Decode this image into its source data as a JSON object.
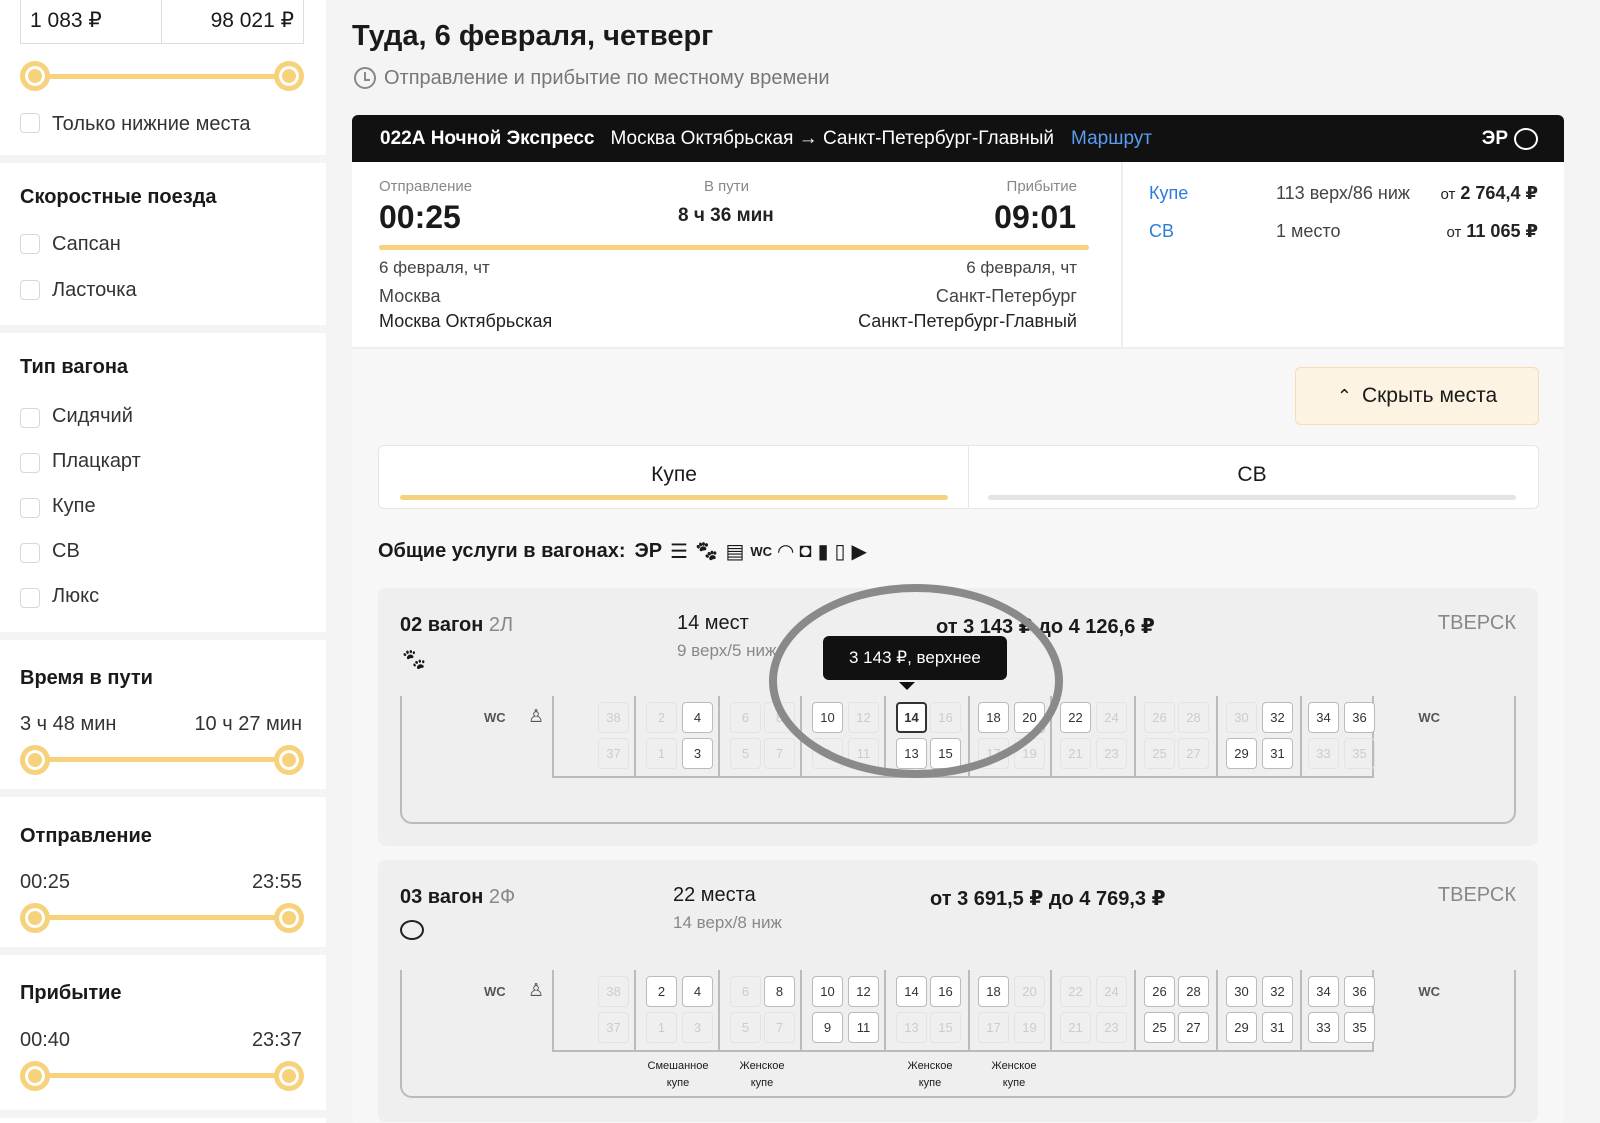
{
  "sidebar": {
    "price": {
      "min": "1 083 ₽",
      "max": "98 021 ₽"
    },
    "only_lower_label": "Только нижние места",
    "fast_trains": {
      "title": "Скоростные поезда",
      "items": [
        "Сапсан",
        "Ласточка"
      ]
    },
    "car_type": {
      "title": "Тип вагона",
      "items": [
        "Сидячий",
        "Плацкарт",
        "Купе",
        "СВ",
        "Люкс"
      ]
    },
    "travel_time": {
      "title": "Время в пути",
      "min": "3 ч 48 мин",
      "max": "10 ч 27 мин"
    },
    "departure": {
      "title": "Отправление",
      "min": "00:25",
      "max": "23:55"
    },
    "arrival": {
      "title": "Прибытие",
      "min": "00:40",
      "max": "23:37"
    }
  },
  "header": {
    "title": "Туда, 6 февраля, четверг",
    "subtitle": "Отправление и прибытие по местному времени"
  },
  "train": {
    "number_name": "022А Ночной Экспресс",
    "route": "Москва Октябрьская → Санкт-Петербург-Главный",
    "route_link": "Маршрут",
    "er_badge": "ЭР",
    "dep_label": "Отправление",
    "dep_time": "00:25",
    "duration_label": "В пути",
    "duration": "8 ч 36 мин",
    "arr_label": "Прибытие",
    "arr_time": "09:01",
    "dep_date": "6 февраля, чт",
    "arr_date": "6 февраля, чт",
    "dep_city": "Москва",
    "dep_station": "Москва Октябрьская",
    "arr_city": "Санкт-Петербург",
    "arr_station": "Санкт-Петербург-Главный",
    "classes": [
      {
        "name": "Купе",
        "seats": "113 верх/86 ниж",
        "from": "от",
        "price": "2 764,4 ₽"
      },
      {
        "name": "СВ",
        "seats": "1 место",
        "from": "от",
        "price": "11 065 ₽"
      }
    ],
    "hide_seats_label": "Скрыть места",
    "tabs": [
      "Купе",
      "СВ"
    ],
    "services_label": "Общие услуги в вагонах:",
    "services_er": "ЭР",
    "services_icons": [
      "bed-linen-icon",
      "pets-icon",
      "shower-icon",
      "wc-icon",
      "wifi-icon",
      "socket-icon",
      "hygiene-kit-icon",
      "slippers-icon",
      "video-icon"
    ]
  },
  "cars": [
    {
      "number": "02 вагон",
      "class": "2Л",
      "seats": "14 мест",
      "seats_detail": "9 верх/5 ниж",
      "price_range": "от 3 143 ₽ до 4 126,6 ₽",
      "carrier": "ТВЕРСК",
      "feature_icon": "pets-icon",
      "wc": "WC",
      "tooltip": "3 143 ₽, верхнее",
      "selected_seat": "14",
      "compartment_labels": []
    },
    {
      "number": "03 вагон",
      "class": "2Ф",
      "seats": "22 места",
      "seats_detail": "14 верх/8 ниж",
      "price_range": "от 3 691,5 ₽ до 4 769,3 ₽",
      "carrier": "ТВЕРСК",
      "feature_icon": "restaurant-icon",
      "wc": "WC",
      "compartment_labels": [
        {
          "line1": "Смешанное",
          "line2": "купе"
        },
        {
          "line1": "Женское",
          "line2": "купе"
        },
        {
          "line1": "Женское",
          "line2": "купе"
        },
        {
          "line1": "Женское",
          "line2": "купе"
        }
      ]
    }
  ],
  "seatmap": {
    "car1_available": [
      "4",
      "3",
      "10",
      "14",
      "13",
      "15",
      "18",
      "20",
      "22",
      "32",
      "29",
      "31",
      "34",
      "36"
    ],
    "car2_available": [
      "2",
      "4",
      "8",
      "10",
      "12",
      "9",
      "11",
      "14",
      "16",
      "18",
      "26",
      "28",
      "25",
      "27",
      "30",
      "32",
      "29",
      "31",
      "34",
      "36",
      "33",
      "35"
    ],
    "top_numbers": [
      "38",
      "2",
      "4",
      "6",
      "8",
      "10",
      "12",
      "14",
      "16",
      "18",
      "20",
      "22",
      "24",
      "26",
      "28",
      "30",
      "32",
      "34",
      "36"
    ],
    "bottom_numbers": [
      "37",
      "1",
      "3",
      "5",
      "7",
      "9",
      "11",
      "13",
      "15",
      "17",
      "19",
      "21",
      "23",
      "25",
      "27",
      "29",
      "31",
      "33",
      "35"
    ]
  }
}
